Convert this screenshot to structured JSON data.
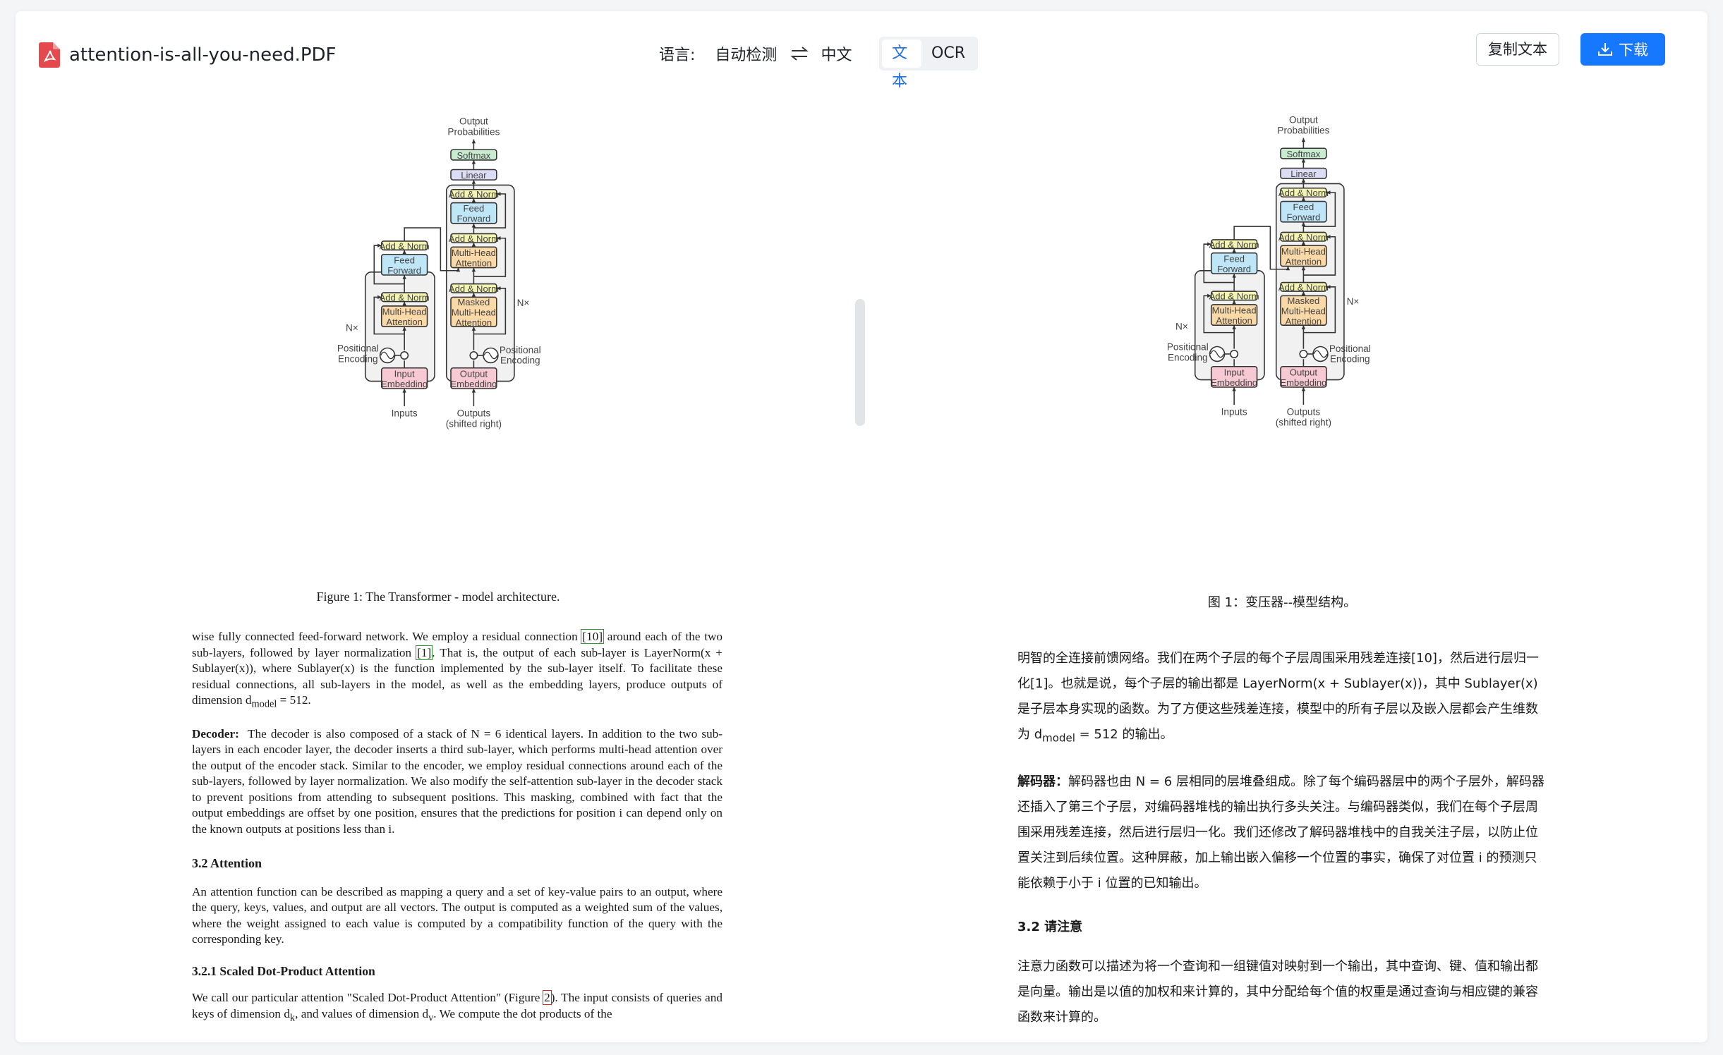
{
  "file": {
    "name": "attention-is-all-you-need.PDF",
    "icon": "pdf-file-icon"
  },
  "language": {
    "label": "语言:",
    "source": "自动检测",
    "target": "中文"
  },
  "mode": {
    "text": "文本",
    "ocr": "OCR"
  },
  "actions": {
    "copy": "复制文本",
    "download": "下载"
  },
  "colors": {
    "accent": "#1677ff",
    "pdf_red": "#e5484d",
    "softmax": "#c9ecd1",
    "linear": "#dcdcf5",
    "addnorm": "#f3f3b2",
    "feed_forward": "#bfe6f7",
    "attention": "#f9d9a8",
    "embedding": "#f7c9d3"
  },
  "diagram": {
    "output_probabilities_1": "Output",
    "output_probabilities_2": "Probabilities",
    "softmax": "Softmax",
    "linear": "Linear",
    "add_norm": "Add & Norm",
    "feed_1": "Feed",
    "feed_2": "Forward",
    "mha_1": "Multi-Head",
    "mha_2": "Attention",
    "masked_1": "Masked",
    "masked_2": "Multi-Head",
    "masked_3": "Attention",
    "nx": "N×",
    "pos_1": "Positional",
    "pos_2": "Encoding",
    "input_emb_1": "Input",
    "input_emb_2": "Embedding",
    "output_emb_1": "Output",
    "output_emb_2": "Embedding",
    "inputs": "Inputs",
    "outputs_1": "Outputs",
    "outputs_2": "(shifted right)"
  },
  "original": {
    "caption": "Figure 1: The Transformer - model architecture.",
    "p1_a": "wise fully connected feed-forward network. We employ a residual connection ",
    "p1_ref1": "[10]",
    "p1_b": " around each of the two sub-layers, followed by layer normalization ",
    "p1_ref2": "[1]",
    "p1_c": ". That is, the output of each sub-layer is LayerNorm(x + Sublayer(x)), where Sublayer(x) is the function implemented by the sub-layer itself. To facilitate these residual connections, all sub-layers in the model, as well as the embedding layers, produce outputs of dimension d",
    "p1_sub": "model",
    "p1_d": " = 512.",
    "decoder_head": "Decoder:",
    "decoder_body": "The decoder is also composed of a stack of N = 6 identical layers. In addition to the two sub-layers in each encoder layer, the decoder inserts a third sub-layer, which performs multi-head attention over the output of the encoder stack. Similar to the encoder, we employ residual connections around each of the sub-layers, followed by layer normalization. We also modify the self-attention sub-layer in the decoder stack to prevent positions from attending to subsequent positions. This masking, combined with fact that the output embeddings are offset by one position, ensures that the predictions for position i can depend only on the known outputs at positions less than i.",
    "h32": "3.2   Attention",
    "attention_body": "An attention function can be described as mapping a query and a set of key-value pairs to an output, where the query, keys, values, and output are all vectors. The output is computed as a weighted sum of the values, where the weight assigned to each value is computed by a compatibility function of the query with the corresponding key.",
    "h321": "3.2.1   Scaled Dot-Product Attention",
    "sdpa_a": "We call our particular attention \"Scaled Dot-Product Attention\" (Figure ",
    "sdpa_ref": "2",
    "sdpa_b": "). The input consists of queries and keys of dimension d",
    "sdpa_sub1": "k",
    "sdpa_c": ", and values of dimension d",
    "sdpa_sub2": "v",
    "sdpa_d": ". We compute the dot products of the"
  },
  "translated": {
    "caption": "图 1：变压器--模型结构。",
    "p1_a": "明智的全连接前馈网络。我们在两个子层的每个子层周围采用残差连接[10]，然后进行层归一化[1]。也就是说，每个子层的输出都是 LayerNorm(x + Sublayer(x))，其中 Sublayer(x) 是子层本身实现的函数。为了方便这些残差连接，模型中的所有子层以及嵌入层都会产生维数为 d",
    "p1_sub": "model",
    "p1_b": " = 512 的输出。",
    "decoder_head": "解码器：",
    "decoder_body": "解码器也由 N = 6 层相同的层堆叠组成。除了每个编码器层中的两个子层外，解码器还插入了第三个子层，对编码器堆栈的输出执行多头关注。与编码器类似，我们在每个子层周围采用残差连接，然后进行层归一化。我们还修改了解码器堆栈中的自我关注子层，以防止位置关注到后续位置。这种屏蔽，加上输出嵌入偏移一个位置的事实，确保了对位置 i 的预测只能依赖于小于 i 位置的已知输出。",
    "h32": "3.2   请注意",
    "attention_body": "注意力函数可以描述为将一个查询和一组键值对映射到一个输出，其中查询、键、值和输出都是向量。输出是以值的加权和来计算的，其中分配给每个值的权重是通过查询与相应键的兼容函数来计算的。"
  }
}
